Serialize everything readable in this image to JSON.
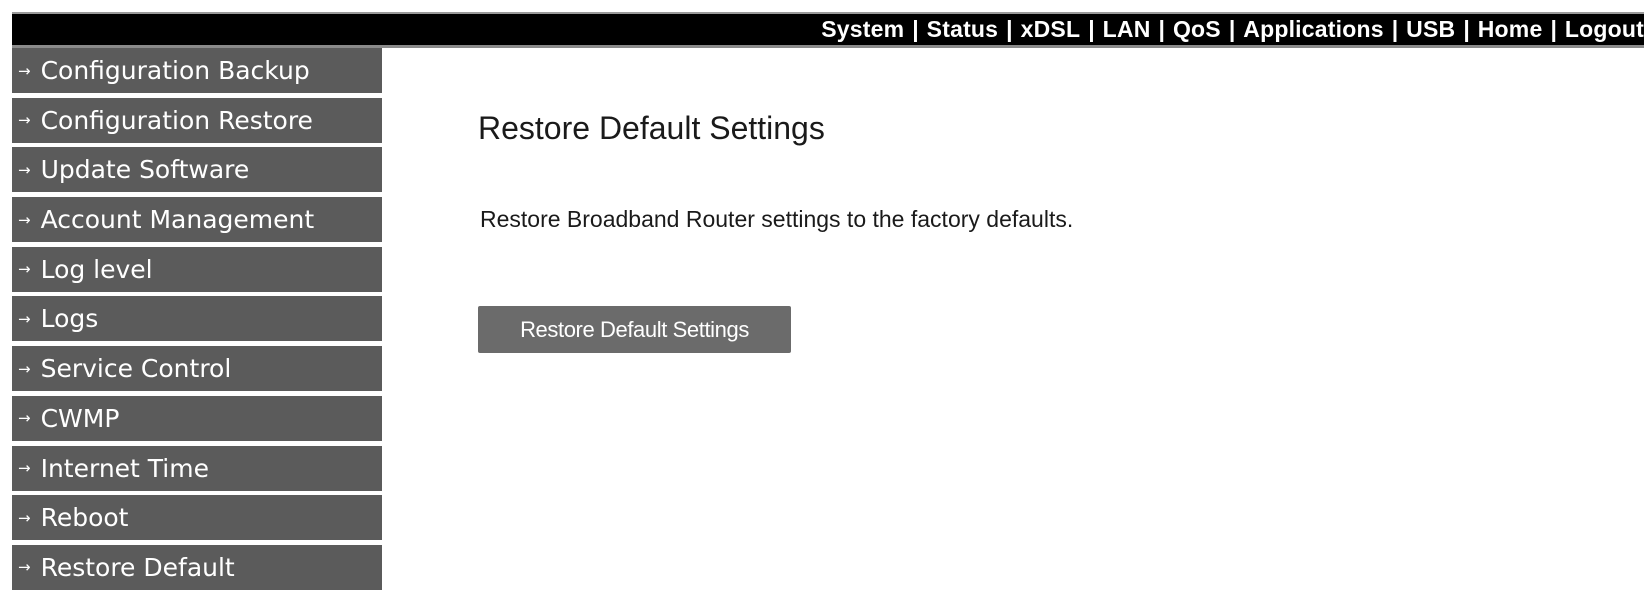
{
  "topnav": {
    "items": [
      {
        "label": "System"
      },
      {
        "label": "Status"
      },
      {
        "label": "xDSL"
      },
      {
        "label": "LAN"
      },
      {
        "label": "QoS"
      },
      {
        "label": "Applications"
      },
      {
        "label": "USB"
      },
      {
        "label": "Home"
      },
      {
        "label": "Logout"
      }
    ],
    "separator": "|"
  },
  "sidebar": {
    "arrow": "→",
    "items": [
      {
        "label": "Configuration Backup"
      },
      {
        "label": "Configuration Restore"
      },
      {
        "label": "Update Software"
      },
      {
        "label": "Account Management"
      },
      {
        "label": "Log level"
      },
      {
        "label": "Logs"
      },
      {
        "label": "Service Control"
      },
      {
        "label": "CWMP"
      },
      {
        "label": "Internet Time"
      },
      {
        "label": "Reboot"
      },
      {
        "label": "Restore Default"
      }
    ]
  },
  "main": {
    "title": "Restore Default Settings",
    "description": "Restore Broadband Router settings to the factory defaults.",
    "button_label": "Restore Default Settings"
  },
  "colors": {
    "topbar_bg": "#000000",
    "sidebar_item_bg": "#5b5b5b",
    "button_bg": "#6b6b6b",
    "text": "#1a1a1a"
  }
}
